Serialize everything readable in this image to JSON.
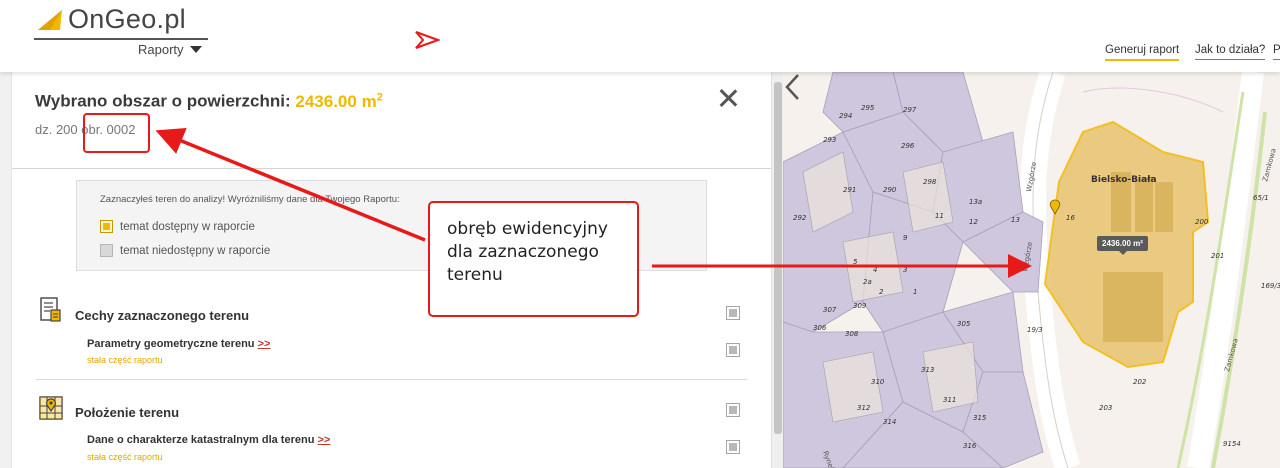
{
  "header": {
    "logo_text": "OnGeo.pl",
    "menu_label": "Raporty",
    "nav": [
      "Generuj raport",
      "Jak to działa?",
      "P"
    ]
  },
  "panel": {
    "title_prefix": "Wybrano obszar o powierzchni: ",
    "area_value": "2436.00 m",
    "area_unit_sup": "2",
    "parcel_id": "dz. 200 obr. 0002",
    "info": {
      "text": "Zaznaczyłeś teren do analizy! Wyróżniliśmy dane dla Twojego Raportu:",
      "legend_available": "temat dostępny w raporcie",
      "legend_unavailable": "temat niedostępny w raporcie"
    },
    "sections": [
      {
        "title": "Cechy zaznaczonego terenu",
        "icon": "document-list-icon",
        "item_title": "Parametry geometryczne terenu",
        "item_more": ">>",
        "item_sub": "stała część raportu"
      },
      {
        "title": "Położenie terenu",
        "icon": "map-pin-icon",
        "item_title": "Dane o charakterze katastralnym dla terenu",
        "item_more": ">>",
        "item_sub": "stała część raportu"
      }
    ]
  },
  "map": {
    "area_label": "2436.00 m²",
    "place_name": "Bielsko-Biała",
    "street_labels": [
      "Wzgórze",
      "Zamkowa",
      "Rynek"
    ],
    "parcel_numbers": [
      "297",
      "295",
      "294",
      "293",
      "296",
      "298",
      "291",
      "292",
      "290",
      "11",
      "13a",
      "12",
      "9",
      "5",
      "4",
      "3",
      "2a",
      "2",
      "1",
      "306",
      "308",
      "310",
      "312",
      "314",
      "316",
      "305",
      "313",
      "311",
      "315",
      "309",
      "307",
      "19/3",
      "16",
      "200",
      "201",
      "202",
      "203",
      "169/3",
      "9154",
      "65/1",
      "13"
    ]
  },
  "annotation": {
    "callout_text": "obręb ewidencyjny dla zaznaczonego terenu"
  },
  "colors": {
    "accent": "#f2b800",
    "annotation_red": "#e81919",
    "parcel_fill": "#e9c46f"
  }
}
